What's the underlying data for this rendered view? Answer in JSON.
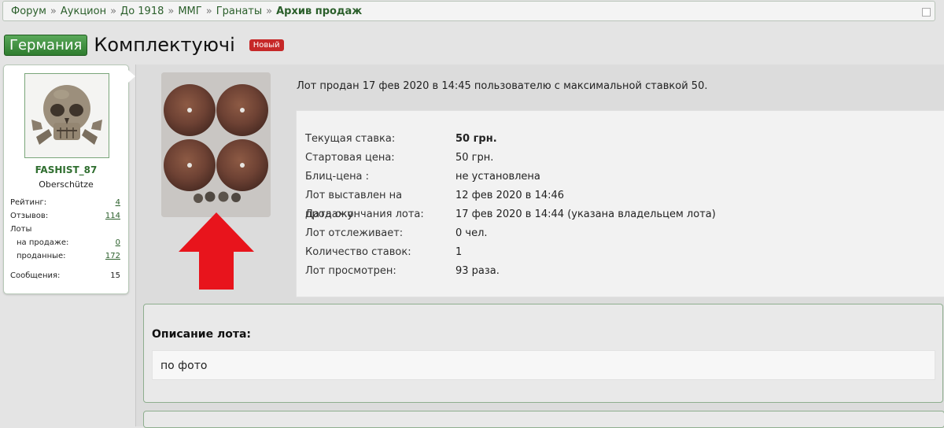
{
  "breadcrumb": {
    "items": [
      "Форум",
      "Аукцион",
      "До 1918",
      "ММГ",
      "Гранаты"
    ],
    "separator": "»",
    "current": "Архив продаж"
  },
  "thread": {
    "prefix": "Германия",
    "title": "Комплектуючі",
    "badge": "Новый"
  },
  "user": {
    "name": "FASHIST_87",
    "rank": "Oberschütze",
    "stats": {
      "rating_label": "Рейтинг:",
      "rating": "4",
      "reviews_label": "Отзывов:",
      "reviews": "114",
      "lots_label": "Лоты",
      "on_sale_label": "на продаже:",
      "on_sale": "0",
      "sold_label": "проданные:",
      "sold": "172",
      "messages_label": "Сообщения:",
      "messages": "15"
    }
  },
  "lot": {
    "sold_text": "Лот продан 17 фев 2020 в 14:45 пользователю с максимальной ставкой 50.",
    "details": [
      {
        "label": "Текущая ставка:",
        "value": "50 грн.",
        "strong": true
      },
      {
        "label": "Стартовая цена:",
        "value": "50 грн."
      },
      {
        "label": "Блиц-цена :",
        "value": "не установлена"
      },
      {
        "label": "Лот выставлен на продажу:",
        "value": "12 фев 2020 в 14:46"
      },
      {
        "label": "Дата окончания лота:",
        "value": "17 фев 2020 в 14:44 (указана владельцем лота)"
      },
      {
        "label": "Лот отслеживает:",
        "value": "0 чел."
      },
      {
        "label": "Количество ставок:",
        "value": "1"
      },
      {
        "label": "Лот просмотрен:",
        "value": "93 раза."
      }
    ],
    "description_title": "Описание лота:",
    "description": "по фото"
  },
  "colors": {
    "accent_green": "#2f7d2f",
    "badge_red": "#c62828",
    "arrow_red": "#e8141c"
  }
}
